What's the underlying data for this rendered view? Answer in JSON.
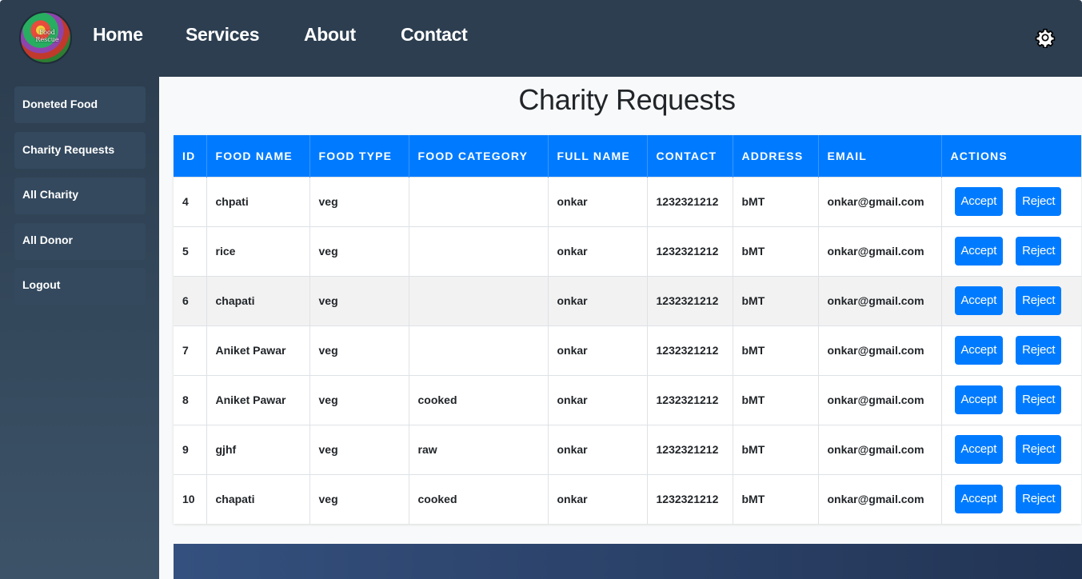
{
  "brand": {
    "logo_text": "Food Rescue"
  },
  "nav": {
    "home": "Home",
    "services": "Services",
    "about": "About",
    "contact": "Contact",
    "settings_icon": "gear-icon"
  },
  "sidebar": {
    "items": [
      {
        "label": "Doneted Food"
      },
      {
        "label": "Charity Requests"
      },
      {
        "label": "All Charity"
      },
      {
        "label": "All Donor"
      },
      {
        "label": "Logout"
      }
    ]
  },
  "page": {
    "title": "Charity Requests"
  },
  "table": {
    "headers": [
      "ID",
      "FOOD NAME",
      "FOOD TYPE",
      "FOOD CATEGORY",
      "FULL NAME",
      "CONTACT",
      "ADDRESS",
      "EMAIL",
      "ACTIONS"
    ],
    "accept_label": "Accept",
    "reject_label": "Reject",
    "rows": [
      {
        "id": "4",
        "food_name": "chpati",
        "food_type": "veg",
        "food_category": "",
        "full_name": "onkar",
        "contact": "1232321212",
        "address": "bMT",
        "email": "onkar@gmail.com"
      },
      {
        "id": "5",
        "food_name": "rice",
        "food_type": "veg",
        "food_category": "",
        "full_name": "onkar",
        "contact": "1232321212",
        "address": "bMT",
        "email": "onkar@gmail.com"
      },
      {
        "id": "6",
        "food_name": "chapati",
        "food_type": "veg",
        "food_category": "",
        "full_name": "onkar",
        "contact": "1232321212",
        "address": "bMT",
        "email": "onkar@gmail.com"
      },
      {
        "id": "7",
        "food_name": "Aniket Pawar",
        "food_type": "veg",
        "food_category": "",
        "full_name": "onkar",
        "contact": "1232321212",
        "address": "bMT",
        "email": "onkar@gmail.com"
      },
      {
        "id": "8",
        "food_name": "Aniket Pawar",
        "food_type": "veg",
        "food_category": "cooked",
        "full_name": "onkar",
        "contact": "1232321212",
        "address": "bMT",
        "email": "onkar@gmail.com"
      },
      {
        "id": "9",
        "food_name": "gjhf",
        "food_type": "veg",
        "food_category": "raw",
        "full_name": "onkar",
        "contact": "1232321212",
        "address": "bMT",
        "email": "onkar@gmail.com"
      },
      {
        "id": "10",
        "food_name": "chapati",
        "food_type": "veg",
        "food_category": "cooked",
        "full_name": "onkar",
        "contact": "1232321212",
        "address": "bMT",
        "email": "onkar@gmail.com"
      }
    ]
  },
  "colors": {
    "header_bg": "#2c3e50",
    "accent": "#007bff",
    "sidebar_item": "#34495e"
  }
}
